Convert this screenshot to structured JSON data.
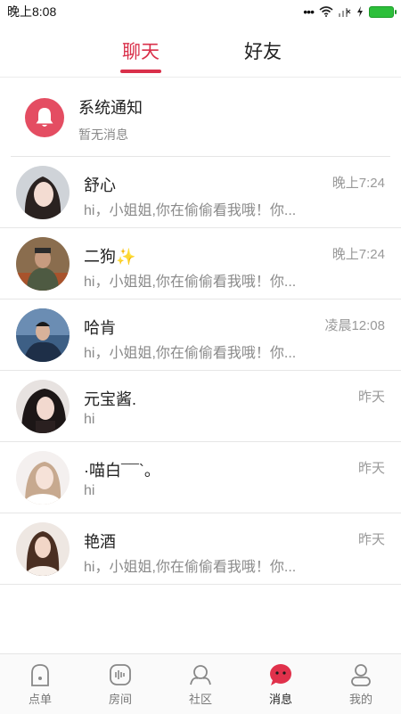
{
  "status_bar": {
    "time": "晚上8:08",
    "icons": [
      "dots-icon",
      "wifi-icon",
      "signal-icon",
      "charging-icon",
      "battery-icon"
    ]
  },
  "tabs": [
    {
      "label": "聊天",
      "active": true
    },
    {
      "label": "好友",
      "active": false
    }
  ],
  "system_notice": {
    "title": "系统通知",
    "subtitle": "暂无消息",
    "icon": "bell-icon",
    "color": "#e44d62"
  },
  "chats": [
    {
      "name": "舒心",
      "time": "晚上7:24",
      "preview": "hi，小姐姐,你在偷偷看我哦！你..."
    },
    {
      "name": "二狗",
      "time": "晚上7:24",
      "preview": "hi，小姐姐,你在偷偷看我哦！你...",
      "badge": "✨"
    },
    {
      "name": "哈肯",
      "time": "凌晨12:08",
      "preview": "hi，小姐姐,你在偷偷看我哦！你..."
    },
    {
      "name": "元宝酱.",
      "time": "昨天",
      "preview": "hi"
    },
    {
      "name": "·喵白¯¯`。",
      "time": "昨天",
      "preview": "hi"
    },
    {
      "name": "艳酒",
      "time": "昨天",
      "preview": "hi，小姐姐,你在偷偷看我哦！你..."
    }
  ],
  "bottom_nav": [
    {
      "label": "点单",
      "icon": "order-icon",
      "active": false
    },
    {
      "label": "房间",
      "icon": "room-icon",
      "active": false
    },
    {
      "label": "社区",
      "icon": "community-icon",
      "active": false
    },
    {
      "label": "消息",
      "icon": "message-icon",
      "active": true
    },
    {
      "label": "我的",
      "icon": "profile-icon",
      "active": false
    }
  ],
  "colors": {
    "accent": "#d9304a",
    "muted": "#8a8a8a"
  }
}
